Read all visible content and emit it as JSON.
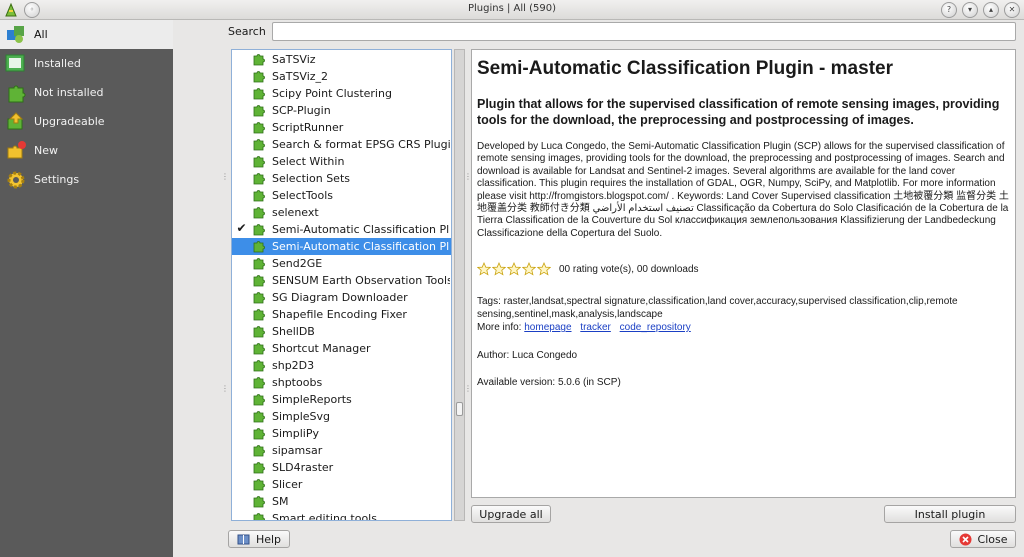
{
  "window": {
    "title": "Plugins | All (590)"
  },
  "categories": [
    {
      "label": "All",
      "icon": "puzzle-all-icon",
      "active": true
    },
    {
      "label": "Installed",
      "icon": "installed-icon",
      "active": false
    },
    {
      "label": "Not installed",
      "icon": "not-installed-icon",
      "active": false
    },
    {
      "label": "Upgradeable",
      "icon": "upgradeable-icon",
      "active": false
    },
    {
      "label": "New",
      "icon": "new-icon",
      "active": false
    },
    {
      "label": "Settings",
      "icon": "settings-gear-icon",
      "active": false
    }
  ],
  "search": {
    "label": "Search",
    "value": ""
  },
  "plugin_list": [
    {
      "name": "SaTSViz",
      "checked": false,
      "selected": false
    },
    {
      "name": "SaTSViz_2",
      "checked": false,
      "selected": false
    },
    {
      "name": "Scipy Point Clustering",
      "checked": false,
      "selected": false
    },
    {
      "name": "SCP-Plugin",
      "checked": false,
      "selected": false
    },
    {
      "name": "ScriptRunner",
      "checked": false,
      "selected": false
    },
    {
      "name": "Search & format EPSG CRS Plugin",
      "checked": false,
      "selected": false
    },
    {
      "name": "Select Within",
      "checked": false,
      "selected": false
    },
    {
      "name": "Selection Sets",
      "checked": false,
      "selected": false
    },
    {
      "name": "SelectTools",
      "checked": false,
      "selected": false
    },
    {
      "name": "selenext",
      "checked": false,
      "selected": false
    },
    {
      "name": "Semi-Automatic Classification Pl",
      "checked": true,
      "selected": false
    },
    {
      "name": "Semi-Automatic Classification Pl",
      "checked": false,
      "selected": true
    },
    {
      "name": "Send2GE",
      "checked": false,
      "selected": false
    },
    {
      "name": "SENSUM Earth Observation Tools",
      "checked": false,
      "selected": false
    },
    {
      "name": "SG Diagram Downloader",
      "checked": false,
      "selected": false
    },
    {
      "name": "Shapefile Encoding Fixer",
      "checked": false,
      "selected": false
    },
    {
      "name": "ShellDB",
      "checked": false,
      "selected": false
    },
    {
      "name": "Shortcut Manager",
      "checked": false,
      "selected": false
    },
    {
      "name": "shp2D3",
      "checked": false,
      "selected": false
    },
    {
      "name": "shptoobs",
      "checked": false,
      "selected": false
    },
    {
      "name": "SimpleReports",
      "checked": false,
      "selected": false
    },
    {
      "name": "SimpleSvg",
      "checked": false,
      "selected": false
    },
    {
      "name": "SimpliPy",
      "checked": false,
      "selected": false
    },
    {
      "name": "sipamsar",
      "checked": false,
      "selected": false
    },
    {
      "name": "SLD4raster",
      "checked": false,
      "selected": false
    },
    {
      "name": "Slicer",
      "checked": false,
      "selected": false
    },
    {
      "name": "SM",
      "checked": false,
      "selected": false
    },
    {
      "name": "Smart editing tools",
      "checked": false,
      "selected": false
    }
  ],
  "details": {
    "title": "Semi-Automatic Classification Plugin - master",
    "subtitle": "Plugin that allows for the supervised classification of remote sensing images, providing tools for the download, the preprocessing and postprocessing of images.",
    "description": "Developed by Luca Congedo, the Semi-Automatic Classification Plugin (SCP) allows for the supervised classification of remote sensing images, providing tools for the download, the preprocessing and postprocessing of images. Search and download is available for Landsat and Sentinel-2 images. Several algorithms are available for the land cover classification. This plugin requires the installation of GDAL, OGR, Numpy, SciPy, and Matplotlib. For more information please visit http://fromgistors.blogspot.com/ . Keywords: Land Cover Supervised classification 土地被覆分類 监督分类 土地覆盖分类 教師付き分類 تصنيف استخدام الأراضي Classificação da Cobertura do Solo Clasificación de la Cobertura de la Tierra Classification de la Couverture du Sol классификация землепользования Klassifizierung der Landbedeckung Classificazione della Copertura del Suolo.",
    "rating_text": "00 rating vote(s), 00 downloads",
    "rating_value": 0,
    "tags": "Tags: raster,landsat,spectral signature,classification,land cover,accuracy,supervised classification,clip,remote sensing,sentinel,mask,analysis,landscape",
    "more_info_label": "More info:",
    "links": [
      "homepage",
      "tracker",
      "code_repository"
    ],
    "author": "Author: Luca Congedo",
    "version": "Available version: 5.0.6 (in SCP)"
  },
  "buttons": {
    "upgrade_all": "Upgrade all",
    "install_plugin": "Install plugin",
    "help": "Help",
    "close": "Close"
  }
}
